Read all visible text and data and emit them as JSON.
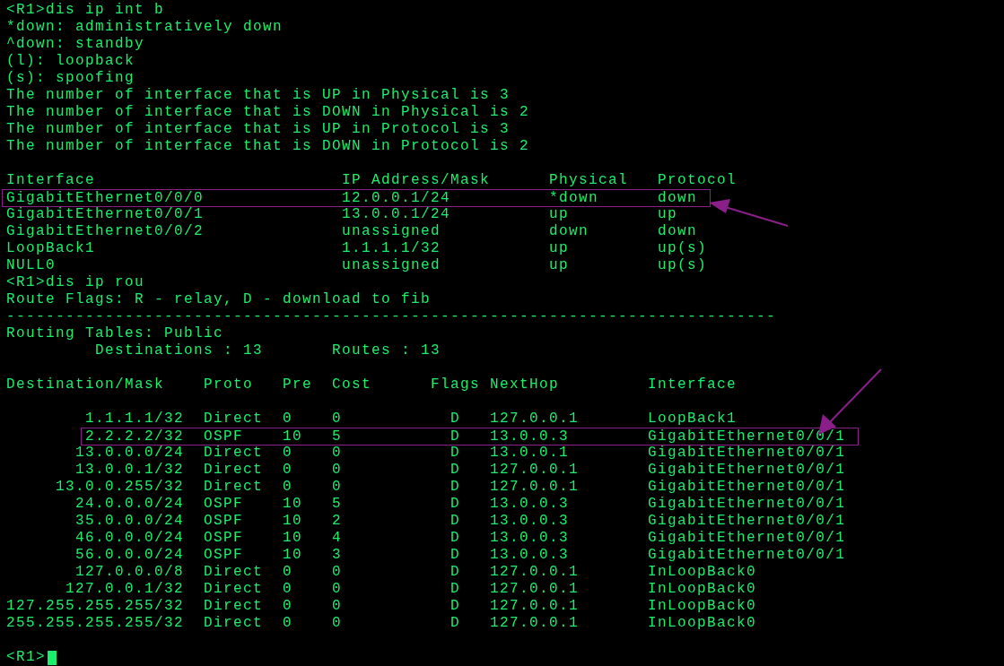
{
  "terminal": {
    "blocks": [
      {
        "lines": [
          {
            "text": "<R1>dis ip int b",
            "highlighted": false
          },
          {
            "text": "*down: administratively down",
            "highlighted": false
          },
          {
            "text": "^down: standby",
            "highlighted": false
          },
          {
            "text": "(l): loopback",
            "highlighted": false
          },
          {
            "text": "(s): spoofing",
            "highlighted": false
          },
          {
            "text": "The number of interface that is UP in Physical is 3",
            "highlighted": false
          },
          {
            "text": "The number of interface that is DOWN in Physical is 2",
            "highlighted": false
          },
          {
            "text": "The number of interface that is UP in Protocol is 3",
            "highlighted": false
          },
          {
            "text": "The number of interface that is DOWN in Protocol is 2",
            "highlighted": false
          }
        ]
      },
      {
        "lines": [
          {
            "text": "Interface                         IP Address/Mask      Physical   Protocol",
            "highlighted": false
          },
          {
            "text": "GigabitEthernet0/0/0              12.0.0.1/24          *down      down",
            "highlighted": true
          },
          {
            "text": "GigabitEthernet0/0/1              13.0.0.1/24          up         up",
            "highlighted": false
          },
          {
            "text": "GigabitEthernet0/0/2              unassigned           down       down",
            "highlighted": false
          },
          {
            "text": "LoopBack1                         1.1.1.1/32           up         up(s)",
            "highlighted": false
          },
          {
            "text": "NULL0                             unassigned           up         up(s)",
            "highlighted": false
          },
          {
            "text": "<R1>dis ip rou",
            "highlighted": false
          },
          {
            "text": "Route Flags: R - relay, D - download to fib",
            "highlighted": false
          },
          {
            "text": "------------------------------------------------------------------------------",
            "highlighted": false
          },
          {
            "text": "Routing Tables: Public",
            "highlighted": false
          },
          {
            "text": "         Destinations : 13       Routes : 13",
            "highlighted": false
          }
        ]
      },
      {
        "lines": [
          {
            "text": "Destination/Mask    Proto   Pre  Cost      Flags NextHop         Interface",
            "highlighted": false
          }
        ]
      },
      {
        "lines": [
          {
            "text": "        1.1.1.1/32  Direct  0    0           D   127.0.0.1       LoopBack1",
            "highlighted": false
          },
          {
            "text": "        2.2.2.2/32  OSPF    10   5           D   13.0.0.3        GigabitEthernet0/0/1",
            "highlighted": true
          },
          {
            "text": "       13.0.0.0/24  Direct  0    0           D   13.0.0.1        GigabitEthernet0/0/1",
            "highlighted": false
          },
          {
            "text": "       13.0.0.1/32  Direct  0    0           D   127.0.0.1       GigabitEthernet0/0/1",
            "highlighted": false
          },
          {
            "text": "     13.0.0.255/32  Direct  0    0           D   127.0.0.1       GigabitEthernet0/0/1",
            "highlighted": false
          },
          {
            "text": "       24.0.0.0/24  OSPF    10   5           D   13.0.0.3        GigabitEthernet0/0/1",
            "highlighted": false
          },
          {
            "text": "       35.0.0.0/24  OSPF    10   2           D   13.0.0.3        GigabitEthernet0/0/1",
            "highlighted": false
          },
          {
            "text": "       46.0.0.0/24  OSPF    10   4           D   13.0.0.3        GigabitEthernet0/0/1",
            "highlighted": false
          },
          {
            "text": "       56.0.0.0/24  OSPF    10   3           D   13.0.0.3        GigabitEthernet0/0/1",
            "highlighted": false
          },
          {
            "text": "       127.0.0.0/8  Direct  0    0           D   127.0.0.1       InLoopBack0",
            "highlighted": false
          },
          {
            "text": "      127.0.0.1/32  Direct  0    0           D   127.0.0.1       InLoopBack0",
            "highlighted": false
          },
          {
            "text": "127.255.255.255/32  Direct  0    0           D   127.0.0.1       InLoopBack0",
            "highlighted": false
          },
          {
            "text": "255.255.255.255/32  Direct  0    0           D   127.0.0.1       InLoopBack0",
            "highlighted": false
          }
        ]
      }
    ],
    "prompt": "<R1>"
  }
}
